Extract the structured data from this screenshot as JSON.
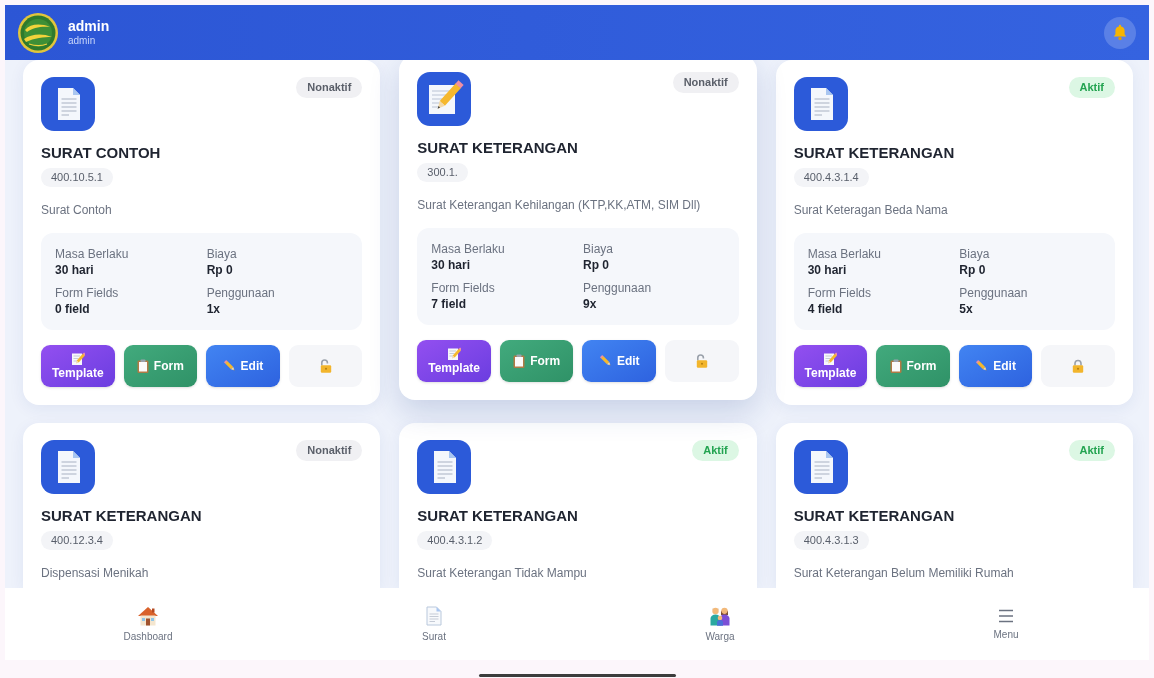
{
  "header": {
    "user_name": "admin",
    "user_role": "admin"
  },
  "cards": [
    {
      "kind": "document",
      "raised": false,
      "status": {
        "label": "Nonaktif",
        "active": false
      },
      "title": "SURAT CONTOH",
      "code": "400.10.5.1",
      "description": "Surat Contoh",
      "details": [
        {
          "label": "Masa Berlaku",
          "value": "30 hari"
        },
        {
          "label": "Biaya",
          "value": "Rp 0"
        },
        {
          "label": "Form Fields",
          "value": "0 field"
        },
        {
          "label": "Penggunaan",
          "value": "1x"
        }
      ],
      "actions": [
        {
          "kind": "template",
          "label": "Template"
        },
        {
          "kind": "form",
          "label": "Form"
        },
        {
          "kind": "edit",
          "label": "Edit"
        },
        {
          "kind": "lock",
          "locked": false
        }
      ]
    },
    {
      "kind": "memo",
      "raised": true,
      "status": {
        "label": "Nonaktif",
        "active": false
      },
      "title": "SURAT KETERANGAN",
      "code": "300.1.",
      "description": "Surat Keterangan Kehilangan (KTP,KK,ATM, SIM Dll)",
      "details": [
        {
          "label": "Masa Berlaku",
          "value": "30 hari"
        },
        {
          "label": "Biaya",
          "value": "Rp 0"
        },
        {
          "label": "Form Fields",
          "value": "7 field"
        },
        {
          "label": "Penggunaan",
          "value": "9x"
        }
      ],
      "actions": [
        {
          "kind": "template",
          "label": "Template"
        },
        {
          "kind": "form",
          "label": "Form"
        },
        {
          "kind": "edit",
          "label": "Edit"
        },
        {
          "kind": "lock",
          "locked": false
        }
      ]
    },
    {
      "kind": "document",
      "raised": false,
      "status": {
        "label": "Aktif",
        "active": true
      },
      "title": "SURAT KETERANGAN",
      "code": "400.4.3.1.4",
      "description": "Surat Keteragan Beda Nama",
      "details": [
        {
          "label": "Masa Berlaku",
          "value": "30 hari"
        },
        {
          "label": "Biaya",
          "value": "Rp 0"
        },
        {
          "label": "Form Fields",
          "value": "4 field"
        },
        {
          "label": "Penggunaan",
          "value": "5x"
        }
      ],
      "actions": [
        {
          "kind": "template",
          "label": "Template"
        },
        {
          "kind": "form",
          "label": "Form"
        },
        {
          "kind": "edit",
          "label": "Edit"
        },
        {
          "kind": "lock",
          "locked": true
        }
      ]
    },
    {
      "kind": "document",
      "raised": false,
      "status": {
        "label": "Nonaktif",
        "active": false
      },
      "title": "SURAT KETERANGAN",
      "code": "400.12.3.4",
      "description": "Dispensasi Menikah"
    },
    {
      "kind": "document",
      "raised": false,
      "status": {
        "label": "Aktif",
        "active": true
      },
      "title": "SURAT KETERANGAN",
      "code": "400.4.3.1.2",
      "description": "Surat Keterangan Tidak Mampu"
    },
    {
      "kind": "document",
      "raised": false,
      "status": {
        "label": "Aktif",
        "active": true
      },
      "title": "SURAT KETERANGAN",
      "code": "400.4.3.1.3",
      "description": "Surat Keterangan Belum Memiliki Rumah"
    }
  ],
  "bottom_nav": [
    {
      "kind": "home",
      "label": "Dashboard"
    },
    {
      "kind": "document",
      "label": "Surat"
    },
    {
      "kind": "people",
      "label": "Warga"
    },
    {
      "kind": "menu",
      "label": "Menu"
    }
  ]
}
